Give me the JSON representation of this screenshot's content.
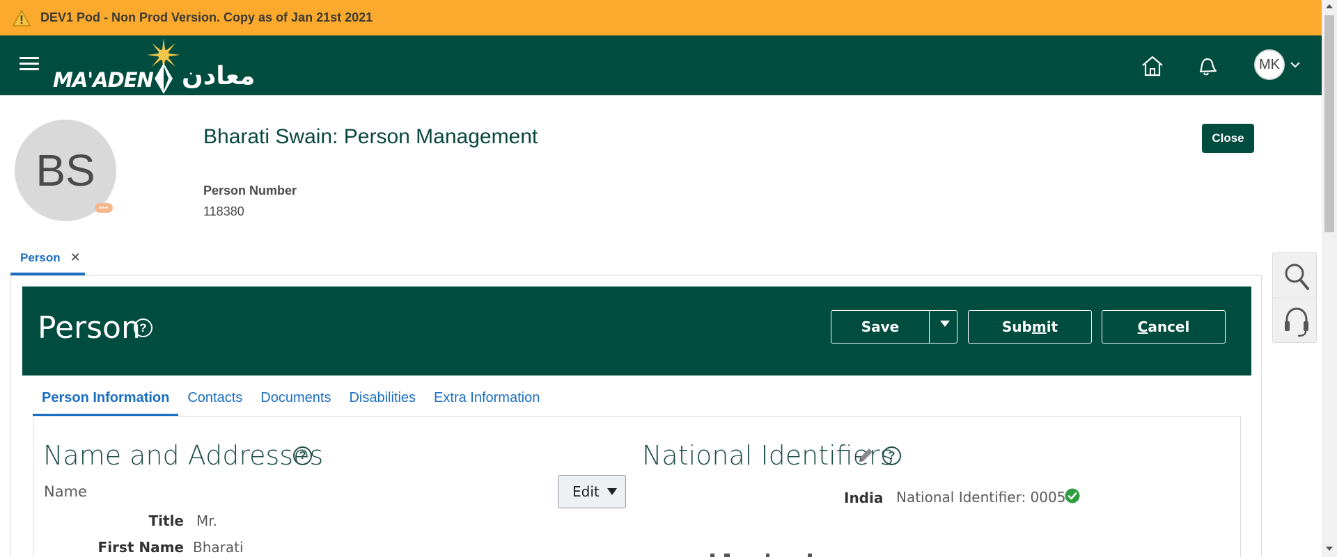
{
  "banner": {
    "text": "DEV1 Pod - Non Prod Version. Copy as of Jan 21st 2021"
  },
  "header": {
    "logo_en": "MA'ADEN",
    "logo_ar": "معادن",
    "avatar_initials": "MK"
  },
  "person": {
    "initials": "BS",
    "more_glyph": "•••",
    "title": "Bharati Swain: Person Management",
    "number_label": "Person Number",
    "number_value": "118380",
    "close_label": "Close"
  },
  "local_tab": {
    "label": "Person",
    "close_glyph": "✕"
  },
  "panel": {
    "title": "Person",
    "help_glyph": "?",
    "save_label": "Save",
    "submit_label": {
      "pre": "Sub",
      "u": "m",
      "post": "it"
    },
    "cancel_label": {
      "u": "C",
      "post": "ancel"
    }
  },
  "subtabs": [
    {
      "label": "Person Information",
      "active": true
    },
    {
      "label": "Contacts"
    },
    {
      "label": "Documents"
    },
    {
      "label": "Disabilities"
    },
    {
      "label": "Extra Information"
    }
  ],
  "name_addresses": {
    "title": "Name and Addresses",
    "help_glyph": "?",
    "sub_heading": "Name",
    "edit_label": "Edit",
    "fields": [
      {
        "label": "Title",
        "value": "Mr."
      },
      {
        "label": "First Name",
        "value": "Bharati"
      }
    ]
  },
  "national_identifiers": {
    "title": "National Identifiers",
    "help_glyph": "?",
    "country": "India",
    "value": "National Identifier: 0005"
  },
  "colors": {
    "banner": "#fcaa2d",
    "brand_green": "#004c3f",
    "link_blue": "#1a6ec2",
    "check_green": "#2e9e3e"
  }
}
